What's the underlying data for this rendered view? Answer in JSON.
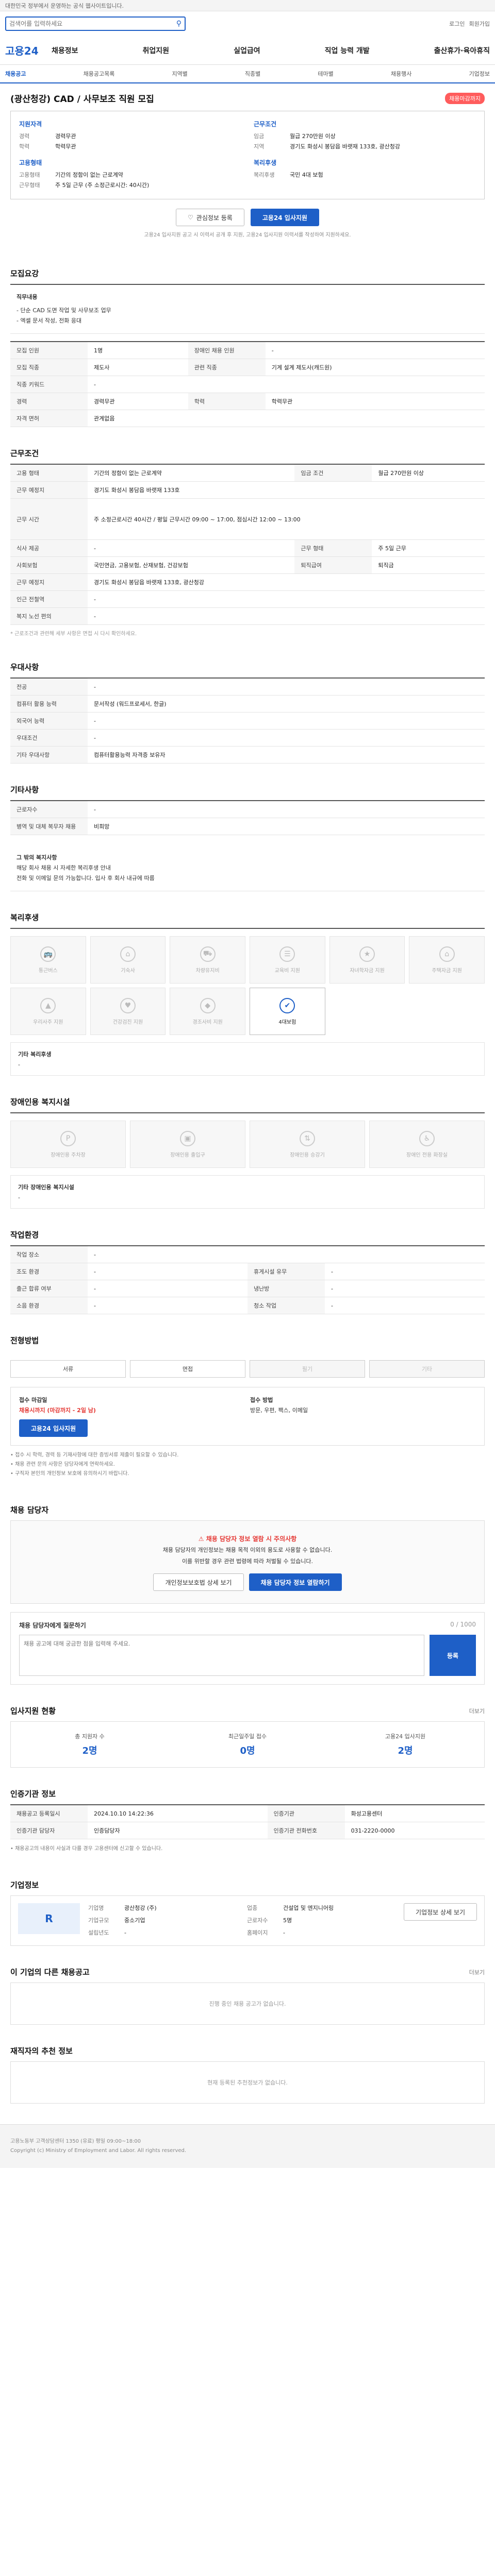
{
  "topbar": {
    "text": "대한민국 정부에서 운영하는 공식 웹사이트입니다."
  },
  "search": {
    "placeholder": "검색어를 입력하세요"
  },
  "util": [
    "로그인",
    "회원가입"
  ],
  "logo": "고용24",
  "gnb": [
    "채용정보",
    "취업지원",
    "실업급여",
    "직업 능력 개발",
    "출산휴가·육아휴직"
  ],
  "lnb": [
    "채용공고",
    "채용공고목록",
    "지역별",
    "직종별",
    "테마별",
    "채용행사",
    "기업정보"
  ],
  "job": {
    "title": "(광산청강) CAD / 사무보조 직원 모집",
    "badge": "채용마감까지",
    "left_h": "지원자격",
    "left_kv": [
      {
        "k": "경력",
        "v": "경력무관"
      },
      {
        "k": "학력",
        "v": "학력무관"
      }
    ],
    "left_h2": "고용형태",
    "left_kv2": [
      {
        "k": "고용형태",
        "v": "기간의 정함이 없는 근로계약"
      },
      {
        "k": "근무형태",
        "v": "주 5일 근무 (주 소정근로시간: 40시간)"
      }
    ],
    "right_h": "근무조건",
    "right_kv": [
      {
        "k": "임금",
        "v": "월급 270만원 이상"
      },
      {
        "k": "지역",
        "v": "경기도 화성시 봉담읍 바랫재 133호, 광산청강"
      }
    ],
    "right_h2": "복리후생",
    "right_kv2": [
      {
        "k": "복리후생",
        "v": "국민 4대 보험"
      }
    ]
  },
  "actions": {
    "scrap": "관심정보 등록",
    "apply": "고용24 입사지원"
  },
  "notice_small": "고용24 입사지원 공고 시 이력서 공개 후 지원, 고용24 입사지원 이력서를 작성하여 지원하세요.",
  "recruit": {
    "title": "모집요강",
    "desc_h": "직무내용",
    "desc": [
      "- 단순 CAD 도면 작업 및 사무보조 업무",
      "- 엑셀 문서 작성, 전화 응대"
    ],
    "rows": [
      [
        "모집 인원",
        "1명",
        "장애인 채용 인원",
        "-"
      ],
      [
        "모집 직종",
        "제도사",
        "관련 직종",
        "기계 설계 제도사(캐드원)"
      ],
      [
        "직종 키워드",
        "-",
        "",
        ""
      ],
      [
        "경력",
        "경력무관",
        "학력",
        "학력무관"
      ],
      [
        "자격 면허",
        "관계없음",
        "",
        ""
      ]
    ]
  },
  "cond": {
    "title": "근무조건",
    "rows": [
      [
        "고용 형태",
        "기간의 정함이 없는 근로계약",
        "임금 조건",
        "월급 270만원 이상"
      ],
      [
        "근무 예정지",
        "경기도 화성시 봉담읍 바랫재 133호",
        "",
        ""
      ],
      [
        "근무 시간",
        "주 소정근로시간 40시간 / 평일 근무시간 09:00 ~ 17:00, 점심시간 12:00 ~ 13:00",
        "",
        ""
      ],
      [
        "식사 제공",
        "-",
        "근무 형태",
        "주 5일 근무"
      ],
      [
        "사회보험",
        "국민연금, 고용보험, 산재보험, 건강보험",
        "퇴직급여",
        "퇴직금"
      ],
      [
        "근무 예정지",
        "경기도 화성시 봉담읍 바랫재 133호, 광산청강",
        "",
        ""
      ],
      [
        "인근 전철역",
        "-",
        "",
        ""
      ],
      [
        "복지 노선 편의",
        "-",
        "",
        ""
      ]
    ],
    "note": "* 근로조건과 관련해 세부 사항은 면접 시 다시 확인하세요."
  },
  "prefer": {
    "title": "우대사항",
    "rows": [
      [
        "전공",
        "-"
      ],
      [
        "컴퓨터 활용 능력",
        "문서작성 (워드프로세서, 한글)"
      ],
      [
        "외국어 능력",
        "-"
      ],
      [
        "우대조건",
        "-"
      ],
      [
        "기타 우대사항",
        "컴퓨터활용능력 자격증 보유자"
      ]
    ]
  },
  "etc": {
    "title": "기타사항",
    "rows": [
      [
        "근로자수",
        "-"
      ],
      [
        "병역 및 대체 복무자 채용",
        "비희망"
      ]
    ],
    "desc_h": "그 밖의 복지사항",
    "desc": "해당 회사 채용 시 자세한 복리후생 안내",
    "desc2": "전화 및 이메일 문의 가능합니다. 입사 후 회사 내규에 따름"
  },
  "welfare": {
    "title": "복리후생",
    "items": [
      {
        "label": "통근버스",
        "icon": "bus-icon",
        "on": false
      },
      {
        "label": "기숙사",
        "icon": "home-icon",
        "on": false
      },
      {
        "label": "차량유지비",
        "icon": "car-icon",
        "on": false
      },
      {
        "label": "교육비 지원",
        "icon": "book-icon",
        "on": false
      },
      {
        "label": "자녀학자금 지원",
        "icon": "cap-icon",
        "on": false
      },
      {
        "label": "주택자금 지원",
        "icon": "house-icon",
        "on": false
      },
      {
        "label": "우리사주 지원",
        "icon": "chart-icon",
        "on": false
      },
      {
        "label": "건강검진 지원",
        "icon": "heart-icon",
        "on": false
      },
      {
        "label": "경조사비 지원",
        "icon": "gift-icon",
        "on": false
      },
      {
        "label": "4대보험",
        "icon": "shield-icon",
        "on": true
      }
    ],
    "etc_h": "기타 복리후생",
    "etc_v": "-"
  },
  "facility": {
    "title": "장애인용 복지시설",
    "items": [
      "장애인용 주차장",
      "장애인용 출입구",
      "장애인용 승강기",
      "장애인 전용 화장실"
    ],
    "etc_h": "기타 장애인용 복지시설",
    "etc_v": "-"
  },
  "place": {
    "title": "작업환경",
    "rows": [
      [
        "작업 장소",
        "-",
        "",
        ""
      ],
      [
        "조도 환경",
        "-",
        "휴게시설 유무",
        "-"
      ],
      [
        "출근 합류 여부",
        "-",
        "냉난방",
        "-"
      ],
      [
        "소음 환경",
        "-",
        "청소 작업",
        "-"
      ]
    ]
  },
  "process": {
    "title": "전형방법",
    "steps": [
      {
        "label": "서류",
        "on": true
      },
      {
        "label": "면접",
        "on": true
      },
      {
        "label": "필기",
        "on": false
      },
      {
        "label": "기타",
        "on": false
      }
    ],
    "apply_h1": "접수 마감일",
    "apply_v1": "채용시까지 (마감까지 - 2일 남)",
    "apply_h2": "접수 방법",
    "apply_v2": "방문, 우편, 팩스, 이메일",
    "apply_btn": "고용24 입사지원",
    "bullets": [
      "• 접수 시 학력, 경력 등 기재사항에 대한 증빙서류 제출이 필요할 수 있습니다.",
      "• 채용 관련 문의 사항은 담당자에게 연락하세요.",
      "• 구직자 본인의 개인정보 보호에 유의하시기 바랍니다."
    ]
  },
  "manager": {
    "title": "채용 담당자",
    "warn": "채용 담당자 정보 열람 시 주의사항",
    "desc1": "채용 담당자의 개인정보는 채용 목적 이외의 용도로 사용할 수 없습니다.",
    "desc2": "이를 위반할 경우 관련 법령에 따라 처벌될 수 있습니다.",
    "btn1": "개인정보보호법 상세 보기",
    "btn2": "채용 담당자 정보 열람하기",
    "inq_h": "채용 담당자에게 질문하기",
    "inq_placeholder": "채용 공고에 대해 궁금한 점을 입력해 주세요.",
    "inq_btn": "등록",
    "inq_count": "0 / 1000"
  },
  "counts": {
    "title": "입사지원 현황",
    "more": "더보기",
    "cells": [
      {
        "label": "총 지원자 수",
        "num": "2명"
      },
      {
        "label": "최근일주일 접수",
        "num": "0명"
      },
      {
        "label": "고용24 입사지원",
        "num": "2명"
      }
    ]
  },
  "agency": {
    "title": "인증기관 정보",
    "rows": [
      [
        "채용공고 등록일시",
        "2024.10.10 14:22:36",
        "인증기관",
        "화성고용센터"
      ],
      [
        "인증기관 담당자",
        "인증담당자",
        "인증기관 전화번호",
        "031-2220-0000"
      ]
    ],
    "bullets": "• 채용공고의 내용이 사실과 다를 경우 고용센터에 신고할 수 있습니다."
  },
  "org": {
    "title": "기업정보",
    "logo_text": "R",
    "rows": [
      [
        "기업명",
        "광산청강 (주)"
      ],
      [
        "업종",
        "건설업 및 엔지니어링"
      ],
      [
        "기업규모",
        "중소기업"
      ],
      [
        "근로자수",
        "5명"
      ],
      [
        "설립년도",
        "-"
      ],
      [
        "홈페이지",
        "-"
      ]
    ],
    "btn": "기업정보 상세 보기"
  },
  "other": {
    "title": "이 기업의 다른 채용공고",
    "more": "더보기",
    "empty": "진행 중인 채용 공고가 없습니다."
  },
  "review": {
    "title": "재직자의 추천 정보",
    "empty": "현재 등록된 추천정보가 없습니다."
  },
  "footer": {
    "line1": "고용노동부 고객상담센터 1350 (유료) 평일 09:00~18:00",
    "line2": "Copyright (c) Ministry of Employment and Labor. All rights reserved."
  }
}
